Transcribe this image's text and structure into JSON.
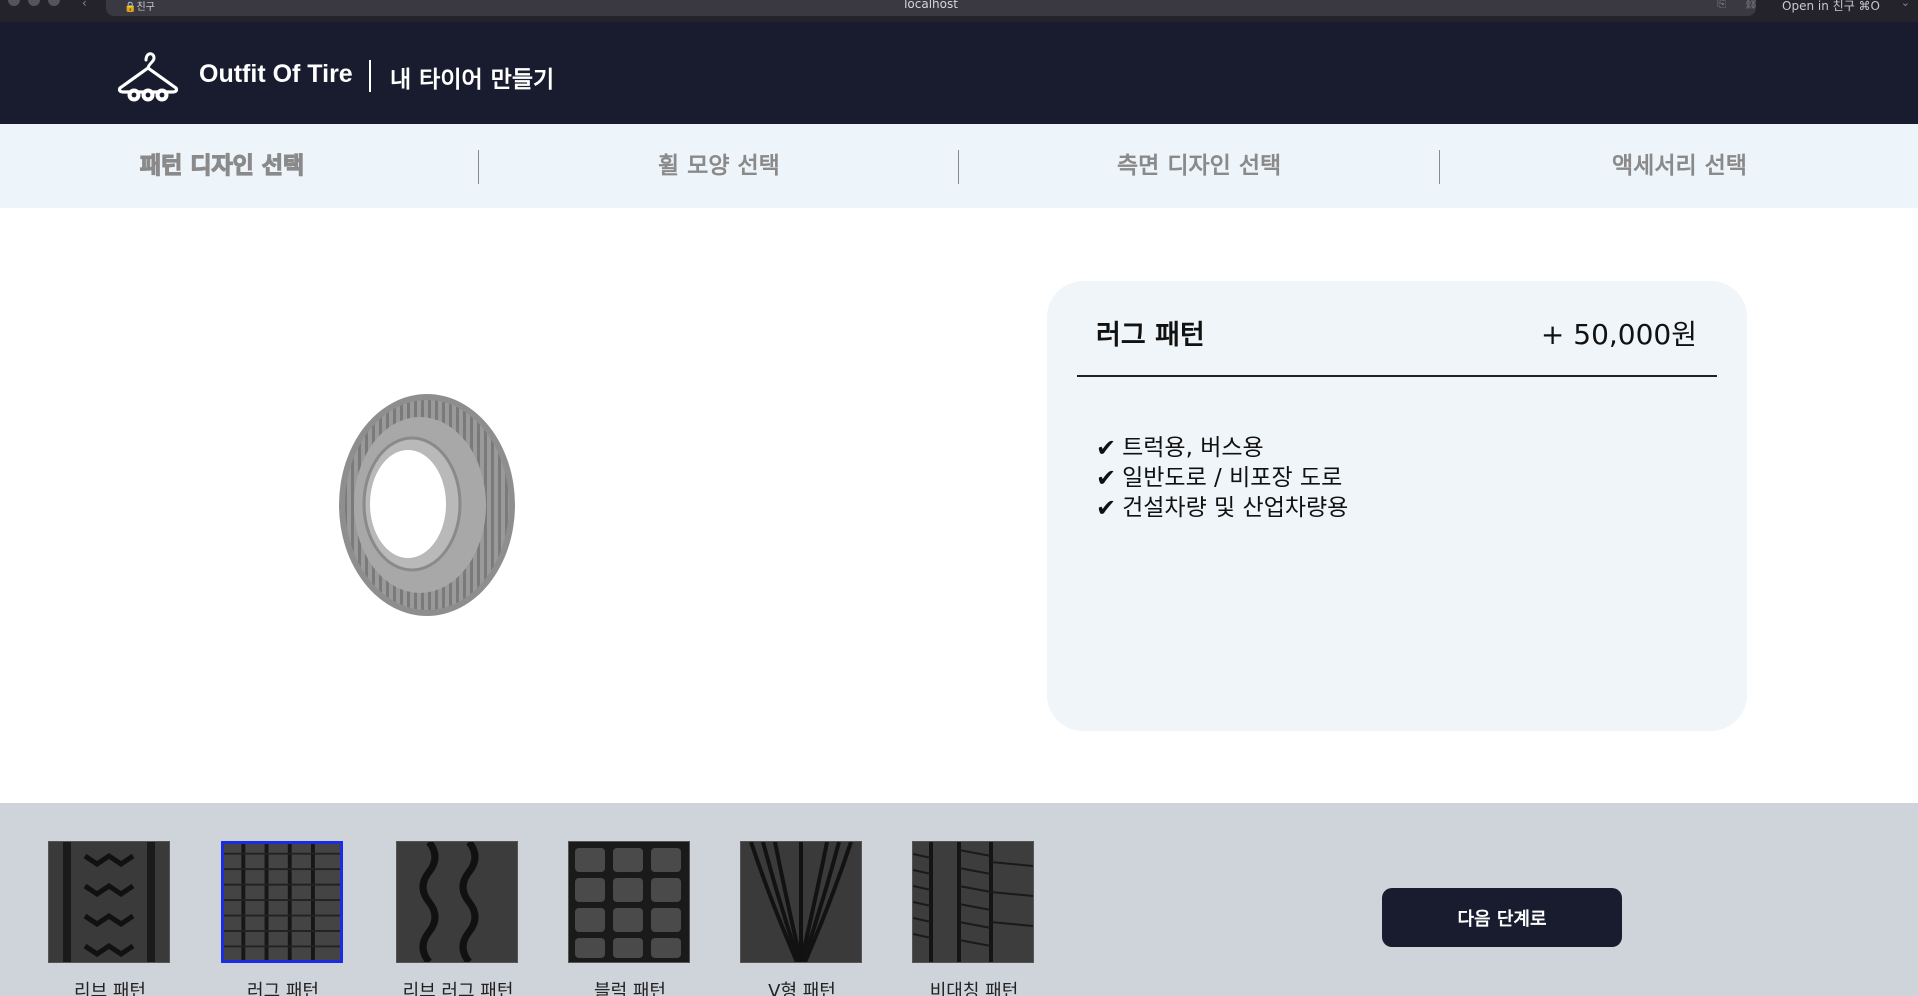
{
  "browser": {
    "tab_label": "친구",
    "url": "localhost",
    "open_in_label": "Open in 친구 ⌘O"
  },
  "header": {
    "brand": "Outfit Of Tire",
    "subtitle": "내 타이어 만들기"
  },
  "steps": [
    {
      "label": "패턴 디자인 선택",
      "active": true
    },
    {
      "label": "휠 모양 선택",
      "active": false
    },
    {
      "label": "측면 디자인 선택",
      "active": false
    },
    {
      "label": "액세서리 선택",
      "active": false
    }
  ],
  "detail": {
    "title": "러그 패턴",
    "price": "+ 50,000원",
    "features": [
      "트럭용, 버스용",
      "일반도로 / 비포장 도로",
      "건설차량 및 산업차량용"
    ]
  },
  "patterns": [
    {
      "label": "리브 패턴",
      "selected": false
    },
    {
      "label": "러그 패턴",
      "selected": true
    },
    {
      "label": "리브 러그 패턴",
      "selected": false
    },
    {
      "label": "블럭 패턴",
      "selected": false
    },
    {
      "label": "V형 패턴",
      "selected": false
    },
    {
      "label": "비대칭 패턴",
      "selected": false
    }
  ],
  "next_button": "다음 단계로",
  "colors": {
    "header_bg": "#181c2e",
    "steps_bg": "#eef5fa",
    "card_bg": "#f0f5f9",
    "tray_bg": "#cfd3da",
    "selected_border": "#1d2ce0"
  }
}
